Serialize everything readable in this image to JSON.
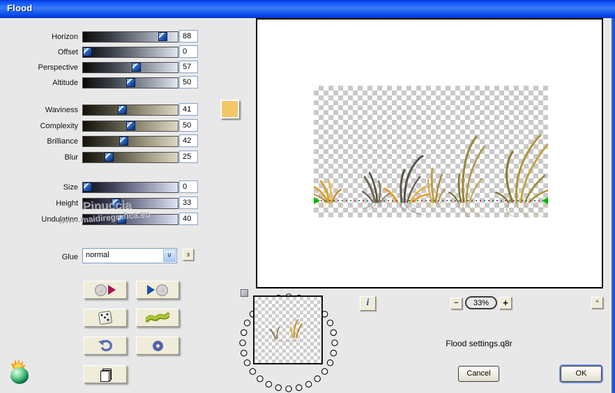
{
  "window": {
    "title": "Flood"
  },
  "sliders": {
    "group1": [
      {
        "label": "Horizon",
        "value": 88
      },
      {
        "label": "Offset",
        "value": 0
      },
      {
        "label": "Perspective",
        "value": 57
      },
      {
        "label": "Altitude",
        "value": 50
      }
    ],
    "group2": [
      {
        "label": "Waviness",
        "value": 41
      },
      {
        "label": "Complexity",
        "value": 50
      },
      {
        "label": "Brilliance",
        "value": 42
      },
      {
        "label": "Blur",
        "value": 25
      }
    ],
    "group3": [
      {
        "label": "Size",
        "value": 0
      },
      {
        "label": "Height",
        "value": 33
      },
      {
        "label": "Undulation",
        "value": 40
      }
    ]
  },
  "glue": {
    "label": "Glue",
    "selected": "normal",
    "dropdown_arrow": "v",
    "memory_button": "s"
  },
  "color_swatch": {
    "color": "#F2C868"
  },
  "watermark": {
    "line1": "Pinuccia",
    "line2": "www.maidiregrafica.eu"
  },
  "preview": {
    "zoom_level": "33%",
    "zoom_out_label": "−",
    "zoom_in_label": "+",
    "info_label": "i",
    "collapse_label": "^"
  },
  "footer": {
    "settings_name": "Flood settings.q8r",
    "cancel_label": "Cancel",
    "ok_label": "OK"
  },
  "icons": {
    "open_preset": "cd-with-red-play-arrow",
    "save_preset": "blue-play-arrow-with-cd",
    "random": "dice",
    "wave": "green-wave",
    "undo": "undo-arrow",
    "water_ring": "blue-ring",
    "copy_settings": "stacked-pages",
    "logo": "flaming-pear"
  },
  "colors": {
    "titlebar": "#0B53F7",
    "button_face": "#EFECDA",
    "focus_ring": "#6E8EDC"
  }
}
